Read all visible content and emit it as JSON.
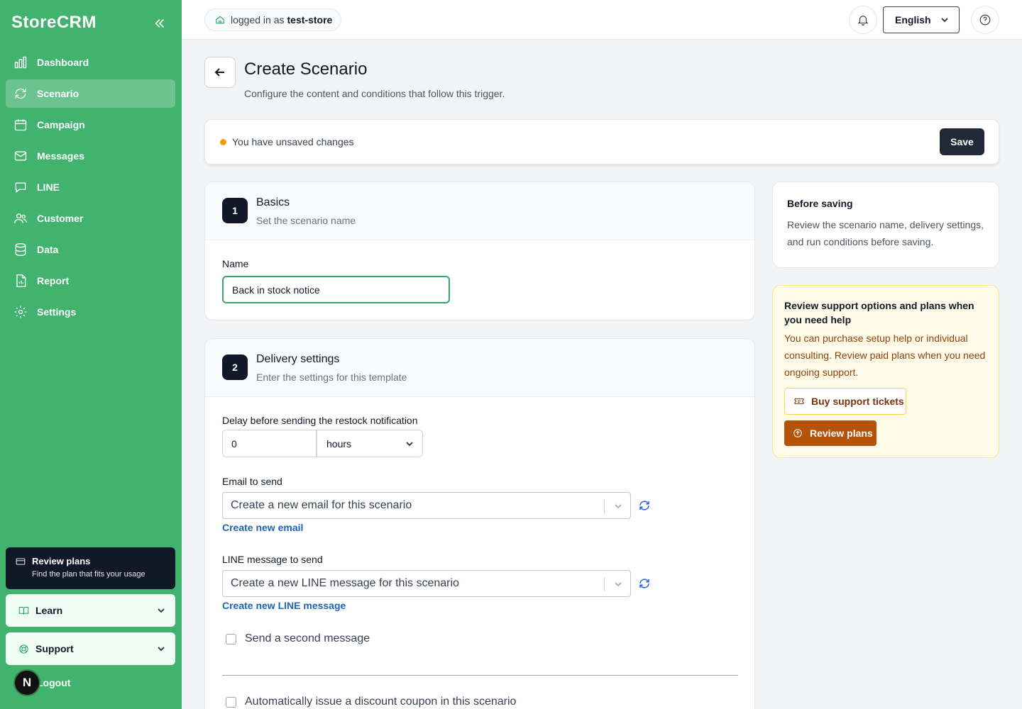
{
  "brand": "StoreCRM",
  "sidebar": {
    "items": [
      {
        "label": "Dashboard",
        "icon": "bar-chart-icon"
      },
      {
        "label": "Scenario",
        "icon": "refresh-icon",
        "active": true
      },
      {
        "label": "Campaign",
        "icon": "calendar-icon"
      },
      {
        "label": "Messages",
        "icon": "mail-icon"
      },
      {
        "label": "LINE",
        "icon": "chat-icon"
      },
      {
        "label": "Customer",
        "icon": "users-icon"
      },
      {
        "label": "Data",
        "icon": "database-icon"
      },
      {
        "label": "Report",
        "icon": "file-chart-icon"
      },
      {
        "label": "Settings",
        "icon": "gear-icon"
      }
    ],
    "promo": {
      "title": "Review plans",
      "subtitle": "Find the plan that fits your usage"
    },
    "learn": "Learn",
    "support": "Support",
    "logout": "Logout",
    "avatar_letter": "N"
  },
  "topbar": {
    "logged_prefix": "logged in as",
    "store": "test-store",
    "language": "English"
  },
  "header": {
    "title": "Create Scenario",
    "subtitle": "Configure the content and conditions that follow this trigger."
  },
  "unsaved": {
    "text": "You have unsaved changes",
    "save_label": "Save",
    "dot_color": "#f59e0b"
  },
  "basics": {
    "step": "1",
    "title": "Basics",
    "subtitle": "Set the scenario name",
    "name_label": "Name",
    "name_value": "Back in stock notice"
  },
  "delivery": {
    "step": "2",
    "title": "Delivery settings",
    "subtitle": "Enter the settings for this template",
    "delay_label": "Delay before sending the restock notification",
    "delay_value": "0",
    "delay_unit": "hours",
    "email_label": "Email to send",
    "email_value": "Create a new email for this scenario",
    "email_link": "Create new email",
    "line_label": "LINE message to send",
    "line_value": "Create a new LINE message for this scenario",
    "line_link": "Create new LINE message",
    "second_message": "Send a second message",
    "coupon": "Automatically issue a discount coupon in this scenario"
  },
  "before_saving": {
    "title": "Before saving",
    "desc": "Review the scenario name, delivery settings, and run conditions before saving."
  },
  "support_box": {
    "title": "Review support options and plans when you need help",
    "desc": "You can purchase setup help or individual consulting. Review paid plans when you need ongoing support.",
    "tickets_label": "Buy support tickets",
    "plans_label": "Review plans"
  },
  "colors": {
    "sidebar": "#42b36f",
    "accent_orange": "#b45309",
    "link": "#1d63b8"
  }
}
